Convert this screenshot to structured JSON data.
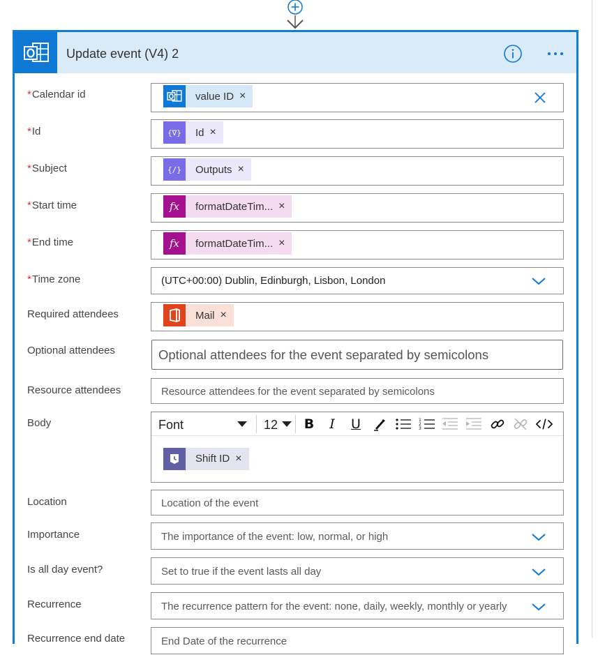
{
  "card": {
    "title": "Update event (V4) 2"
  },
  "fields": {
    "calendar_id": {
      "label": "Calendar id",
      "token": "value ID"
    },
    "id": {
      "label": "Id",
      "token": "Id"
    },
    "subject": {
      "label": "Subject",
      "token": "Outputs"
    },
    "start_time": {
      "label": "Start time",
      "token": "formatDateTim..."
    },
    "end_time": {
      "label": "End time",
      "token": "formatDateTim..."
    },
    "time_zone": {
      "label": "Time zone",
      "value": "(UTC+00:00) Dublin, Edinburgh, Lisbon, London"
    },
    "required_attendees": {
      "label": "Required attendees",
      "token": "Mail"
    },
    "optional_attendees": {
      "label": "Optional attendees",
      "placeholder": "Optional attendees for the event separated by semicolons"
    },
    "resource_attendees": {
      "label": "Resource attendees",
      "placeholder": "Resource attendees for the event separated by semicolons"
    },
    "body": {
      "label": "Body",
      "token": "Shift ID",
      "font": "Font",
      "size": "12"
    },
    "location": {
      "label": "Location",
      "placeholder": "Location of the event"
    },
    "importance": {
      "label": "Importance",
      "placeholder": "The importance of the event: low, normal, or high"
    },
    "is_all_day": {
      "label": "Is all day event?",
      "placeholder": "Set to true if the event lasts all day"
    },
    "recurrence": {
      "label": "Recurrence",
      "placeholder": "The recurrence pattern for the event: none, daily, weekly, monthly or yearly"
    },
    "recurrence_end": {
      "label": "Recurrence end date",
      "placeholder": "End Date of the recurrence"
    }
  },
  "required_marker": "*",
  "token_remove": "×",
  "colors": {
    "accent": "#0f78d4",
    "header_bg": "#d9ebf9",
    "required": "#d13438",
    "outlook_token_bg": "#d6e8f8",
    "variable_icon": "#7a6ce8",
    "variable_token_bg": "#ece8fc",
    "expression_icon": "#a4108e",
    "expression_token_bg": "#f4dbef",
    "office_icon": "#e0441c",
    "office_token_bg": "#fbe0d8",
    "shifts_icon": "#5f5fa3",
    "shifts_token_bg": "#e4e4f0"
  }
}
